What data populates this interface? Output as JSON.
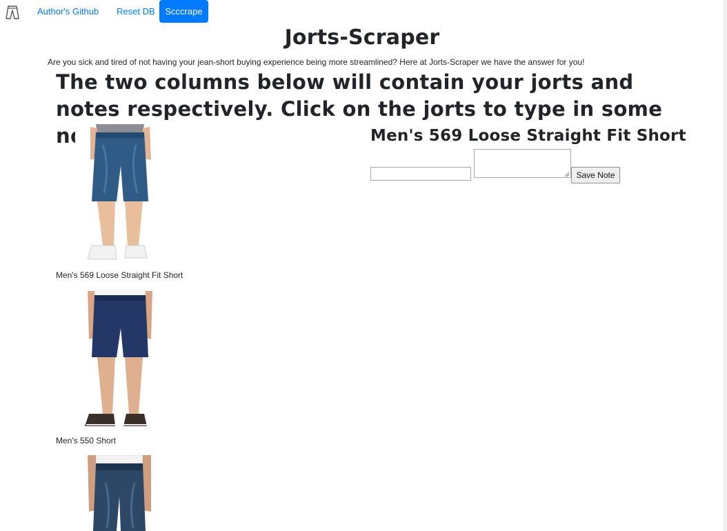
{
  "navbar": {
    "brand_icon": "jorts-icon",
    "links": [
      "Author's Github",
      "Reset DB"
    ],
    "scrape_button": "Scccrape",
    "accent": "#007bff"
  },
  "header": {
    "title": "Jorts-Scraper",
    "intro": "Are you sick and tired of not having your jean-short buying experience being more streamlined? Here at Jorts-Scraper we have the answer for you!",
    "subheading": "The two columns below will contain your jorts and notes respectively. Click on the jorts to type in some notes."
  },
  "jorts": [
    {
      "name": "Men's 569 Loose Straight Fit Short",
      "shoe": "white-sneakers"
    },
    {
      "name": "Men's 550 Short",
      "shoe": "dark-sneakers"
    },
    {
      "name": "",
      "shoe": "none"
    }
  ],
  "notes": {
    "title": "Men's 569 Loose Straight Fit Short",
    "title_value": "",
    "body_value": "",
    "save_button": "Save Note"
  }
}
